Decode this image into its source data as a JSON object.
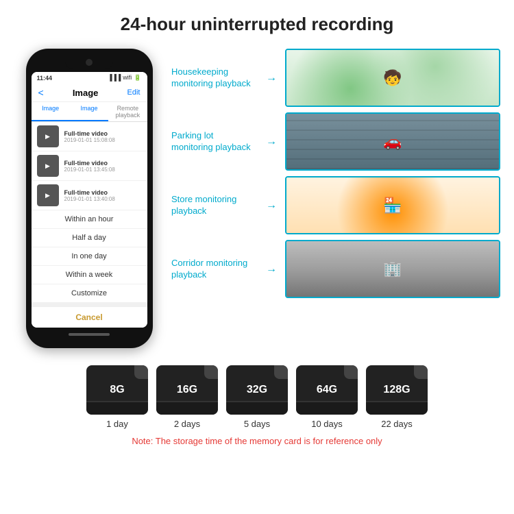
{
  "title": "24-hour uninterrupted recording",
  "phone": {
    "status_time": "11:44",
    "header_back": "<",
    "header_title": "Image",
    "header_edit": "Edit",
    "tab_image": "Image",
    "tab_image2": "Image",
    "tab_remote": "Remote playback",
    "videos": [
      {
        "title": "Full-time video",
        "date": "2019-01-01 15:08:08"
      },
      {
        "title": "Full-time video",
        "date": "2019-01-01 13:45:08"
      },
      {
        "title": "Full-time video",
        "date": "2019-01-01 13:40:08"
      }
    ],
    "dropdown_items": [
      "Within an hour",
      "Half a day",
      "In one day",
      "Within a week",
      "Customize"
    ],
    "cancel_label": "Cancel"
  },
  "monitoring": [
    {
      "label": "Housekeeping\nmonitoring playback",
      "photo_type": "kids",
      "emoji": "🧒"
    },
    {
      "label": "Parking lot\nmonitoring playback",
      "photo_type": "parking",
      "emoji": "🚗"
    },
    {
      "label": "Store monitoring\nplayback",
      "photo_type": "store",
      "emoji": "🏪"
    },
    {
      "label": "Corridor monitoring\nplayback",
      "photo_type": "corridor",
      "emoji": "🏢"
    }
  ],
  "sd_cards": [
    {
      "size": "8G",
      "days": "1 day"
    },
    {
      "size": "16G",
      "days": "2 days"
    },
    {
      "size": "32G",
      "days": "5 days"
    },
    {
      "size": "64G",
      "days": "10 days"
    },
    {
      "size": "128G",
      "days": "22 days"
    }
  ],
  "note": "Note: The storage time of the memory card is for reference only"
}
